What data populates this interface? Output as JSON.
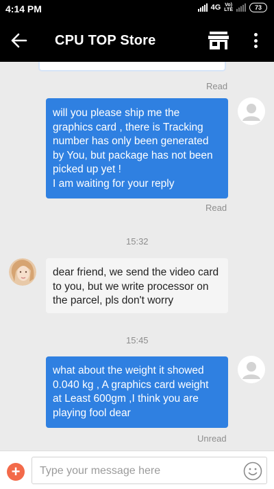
{
  "status_bar": {
    "time": "4:14 PM",
    "network": "4G",
    "volte_1": "Vo)",
    "volte_2": "LTE",
    "battery": "73"
  },
  "app_bar": {
    "title": "CPU TOP Store",
    "back_icon": "arrow-left-icon",
    "store_icon": "storefront-icon",
    "more_icon": "more-vert-icon"
  },
  "colors": {
    "outgoing_bubble": "#2f80e1",
    "incoming_bubble": "#f5f5f5",
    "background": "#ebebeb",
    "add_button": "#f36a4a"
  },
  "messages": [
    {
      "direction": "out",
      "status": "Read"
    },
    {
      "direction": "out",
      "lines": [
        "will you please ship me the",
        "graphics card , there is  Tracking",
        "number has only been generated",
        "by You, but package has not been",
        "picked up yet !",
        "I am waiting for your reply"
      ],
      "status": "Read"
    },
    {
      "timestamp": "15:32"
    },
    {
      "direction": "in",
      "lines": [
        "dear friend, we send the video card",
        "to you, but we write processor on",
        "the parcel, pls don't worry"
      ]
    },
    {
      "timestamp": "15:45"
    },
    {
      "direction": "out",
      "lines": [
        "what about the weight it showed",
        "0.040 kg , A graphics card weight",
        "at Least 600gm ,I think you are",
        "playing fool dear"
      ],
      "status": "Unread"
    }
  ],
  "input": {
    "placeholder": "Type your message here",
    "add_icon": "plus-icon",
    "emoji_icon": "emoji-icon"
  }
}
